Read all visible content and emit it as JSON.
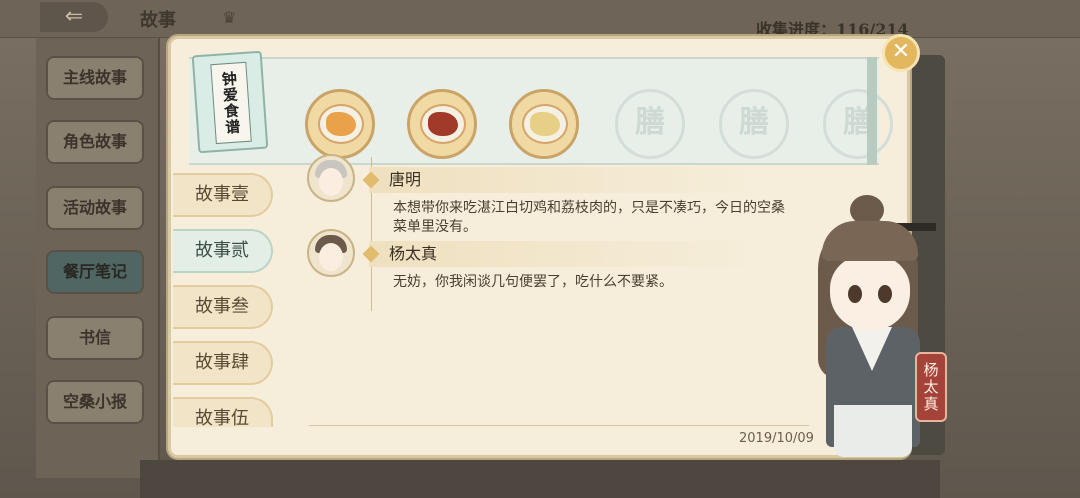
{
  "background": {
    "back_icon": "back-arrow-icon",
    "title": "故事",
    "progress_text": "收集进度：116/214",
    "sidebar_items": [
      {
        "label": "主线故事"
      },
      {
        "label": "角色故事"
      },
      {
        "label": "活动故事"
      },
      {
        "label": "餐厅笔记",
        "active": true
      },
      {
        "label": "书信"
      },
      {
        "label": "空桑小报"
      }
    ]
  },
  "dialog": {
    "recipe_book_title": "钟爱食谱",
    "dishes": [
      {
        "icon": "dish-fish-icon",
        "color": "#e9a24a"
      },
      {
        "icon": "dish-lychee-pork-icon",
        "color": "#a23a2a"
      },
      {
        "icon": "dish-soup-icon",
        "color": "#e7cf86"
      }
    ],
    "locked_slots": [
      "膳",
      "膳",
      "膳"
    ],
    "tabs": [
      {
        "label": "故事壹"
      },
      {
        "label": "故事贰",
        "active": true
      },
      {
        "label": "故事叁"
      },
      {
        "label": "故事肆"
      },
      {
        "label": "故事伍"
      }
    ],
    "conversation": [
      {
        "speaker": "唐明",
        "text": "本想带你来吃湛江白切鸡和荔枝肉的，只是不凑巧，今日的空桑菜单里没有。"
      },
      {
        "speaker": "杨太真",
        "text": "无妨，你我闲谈几句便罢了，吃什么不要紧。"
      }
    ],
    "date": "2019/10/09",
    "close_icon": "close-icon"
  },
  "character": {
    "name": "杨太真"
  },
  "colors": {
    "accent_gold": "#e1bb6e",
    "banner_red": "#a5423a",
    "active_tab": "#e3efe6"
  }
}
